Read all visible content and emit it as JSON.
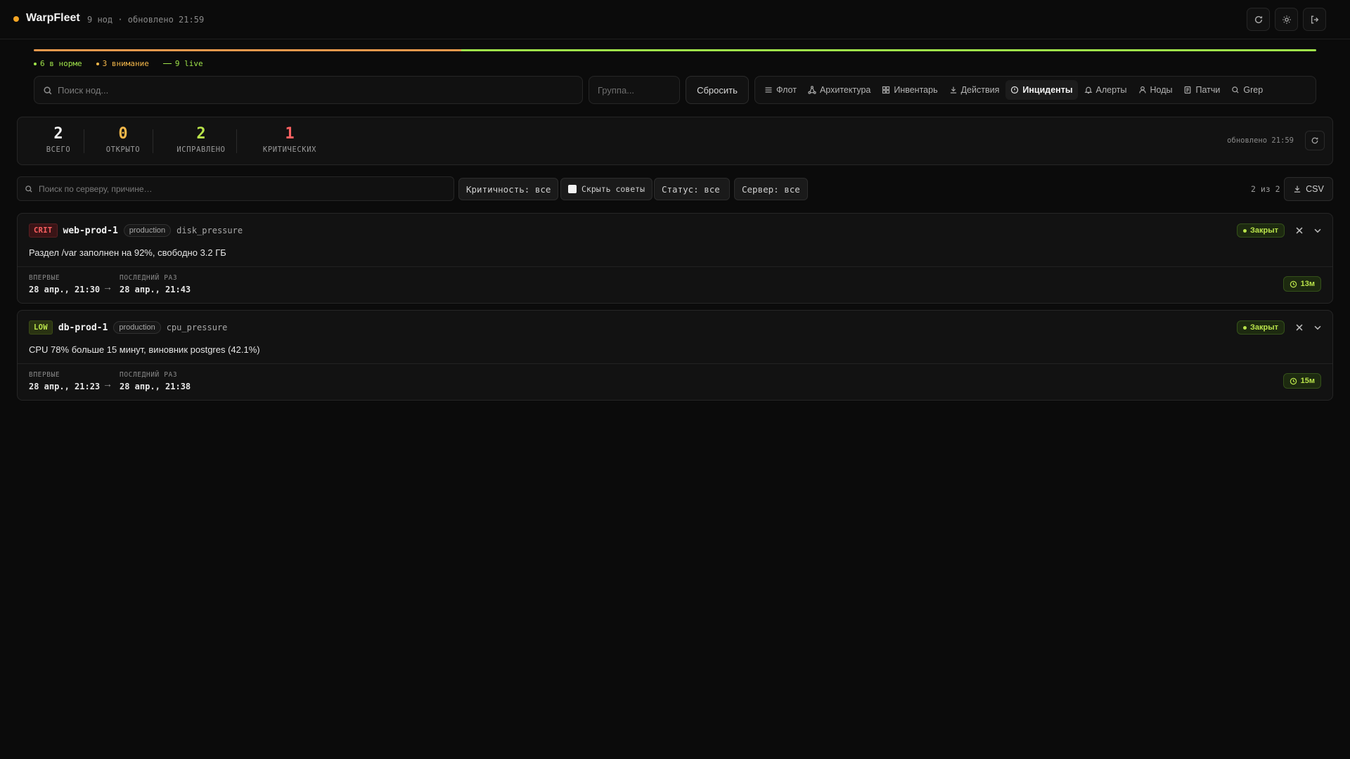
{
  "app": {
    "name": "WarpFleet",
    "meta": "9 нод · обновлено 21:59"
  },
  "header": {
    "buttons": [
      "refresh-icon",
      "sun-icon",
      "logout-icon"
    ]
  },
  "health": {
    "ok_label": "6 в норме",
    "warn_label": "3 внимание",
    "live_label": "9 live",
    "ok_count": 6,
    "warn_count": 3,
    "colors": {
      "ok": "#9fe34a",
      "warn": "#e9994d"
    }
  },
  "toolbar": {
    "search_placeholder": "Поиск нод...",
    "group_placeholder": "Группа...",
    "reset_label": "Сбросить"
  },
  "nav": {
    "items": [
      {
        "label": "Флот",
        "icon": "list-icon"
      },
      {
        "label": "Архитектура",
        "icon": "network-icon"
      },
      {
        "label": "Инвентарь",
        "icon": "grid-icon"
      },
      {
        "label": "Действия",
        "icon": "download-icon"
      },
      {
        "label": "Инциденты",
        "icon": "alert-circle-icon",
        "active": true
      },
      {
        "label": "Алерты",
        "icon": "bell-icon"
      },
      {
        "label": "Ноды",
        "icon": "user-icon"
      },
      {
        "label": "Патчи",
        "icon": "file-icon"
      },
      {
        "label": "Grep",
        "icon": "search-icon"
      }
    ]
  },
  "stats": {
    "items": [
      {
        "value": "2",
        "label": "ВСЕГО",
        "color": "#f2f2f2"
      },
      {
        "value": "0",
        "label": "ОТКРЫТО",
        "color": "#f5b84a"
      },
      {
        "value": "2",
        "label": "ИСПРАВЛЕНО",
        "color": "#b9e34a"
      },
      {
        "value": "1",
        "label": "КРИТИЧЕСКИХ",
        "color": "#ff6161"
      }
    ],
    "updated": "обновлено 21:59"
  },
  "filters": {
    "search_placeholder": "Поиск по серверу, причине…",
    "severity": "Критичность: все",
    "hide_tips": "Скрыть советы",
    "status": "Статус: все",
    "server": "Сервер: все",
    "count": "2 из 2",
    "csv": "CSV"
  },
  "incidents": [
    {
      "severity": "CRIT",
      "host": "web-prod-1",
      "env": "production",
      "type": "disk_pressure",
      "message": "Раздел /var заполнен на 92%, свободно 3.2 ГБ",
      "status": "Закрыт",
      "first_label": "ВПЕРВЫЕ",
      "first_value": "28 апр., 21:30",
      "last_label": "ПОСЛЕДНИЙ РАЗ",
      "last_value": "28 апр., 21:43",
      "duration": "13м"
    },
    {
      "severity": "LOW",
      "host": "db-prod-1",
      "env": "production",
      "type": "cpu_pressure",
      "message": "CPU 78% больше 15 минут, виновник postgres (42.1%)",
      "status": "Закрыт",
      "first_label": "ВПЕРВЫЕ",
      "first_value": "28 апр., 21:23",
      "last_label": "ПОСЛЕДНИЙ РАЗ",
      "last_value": "28 апр., 21:38",
      "duration": "15м"
    }
  ]
}
